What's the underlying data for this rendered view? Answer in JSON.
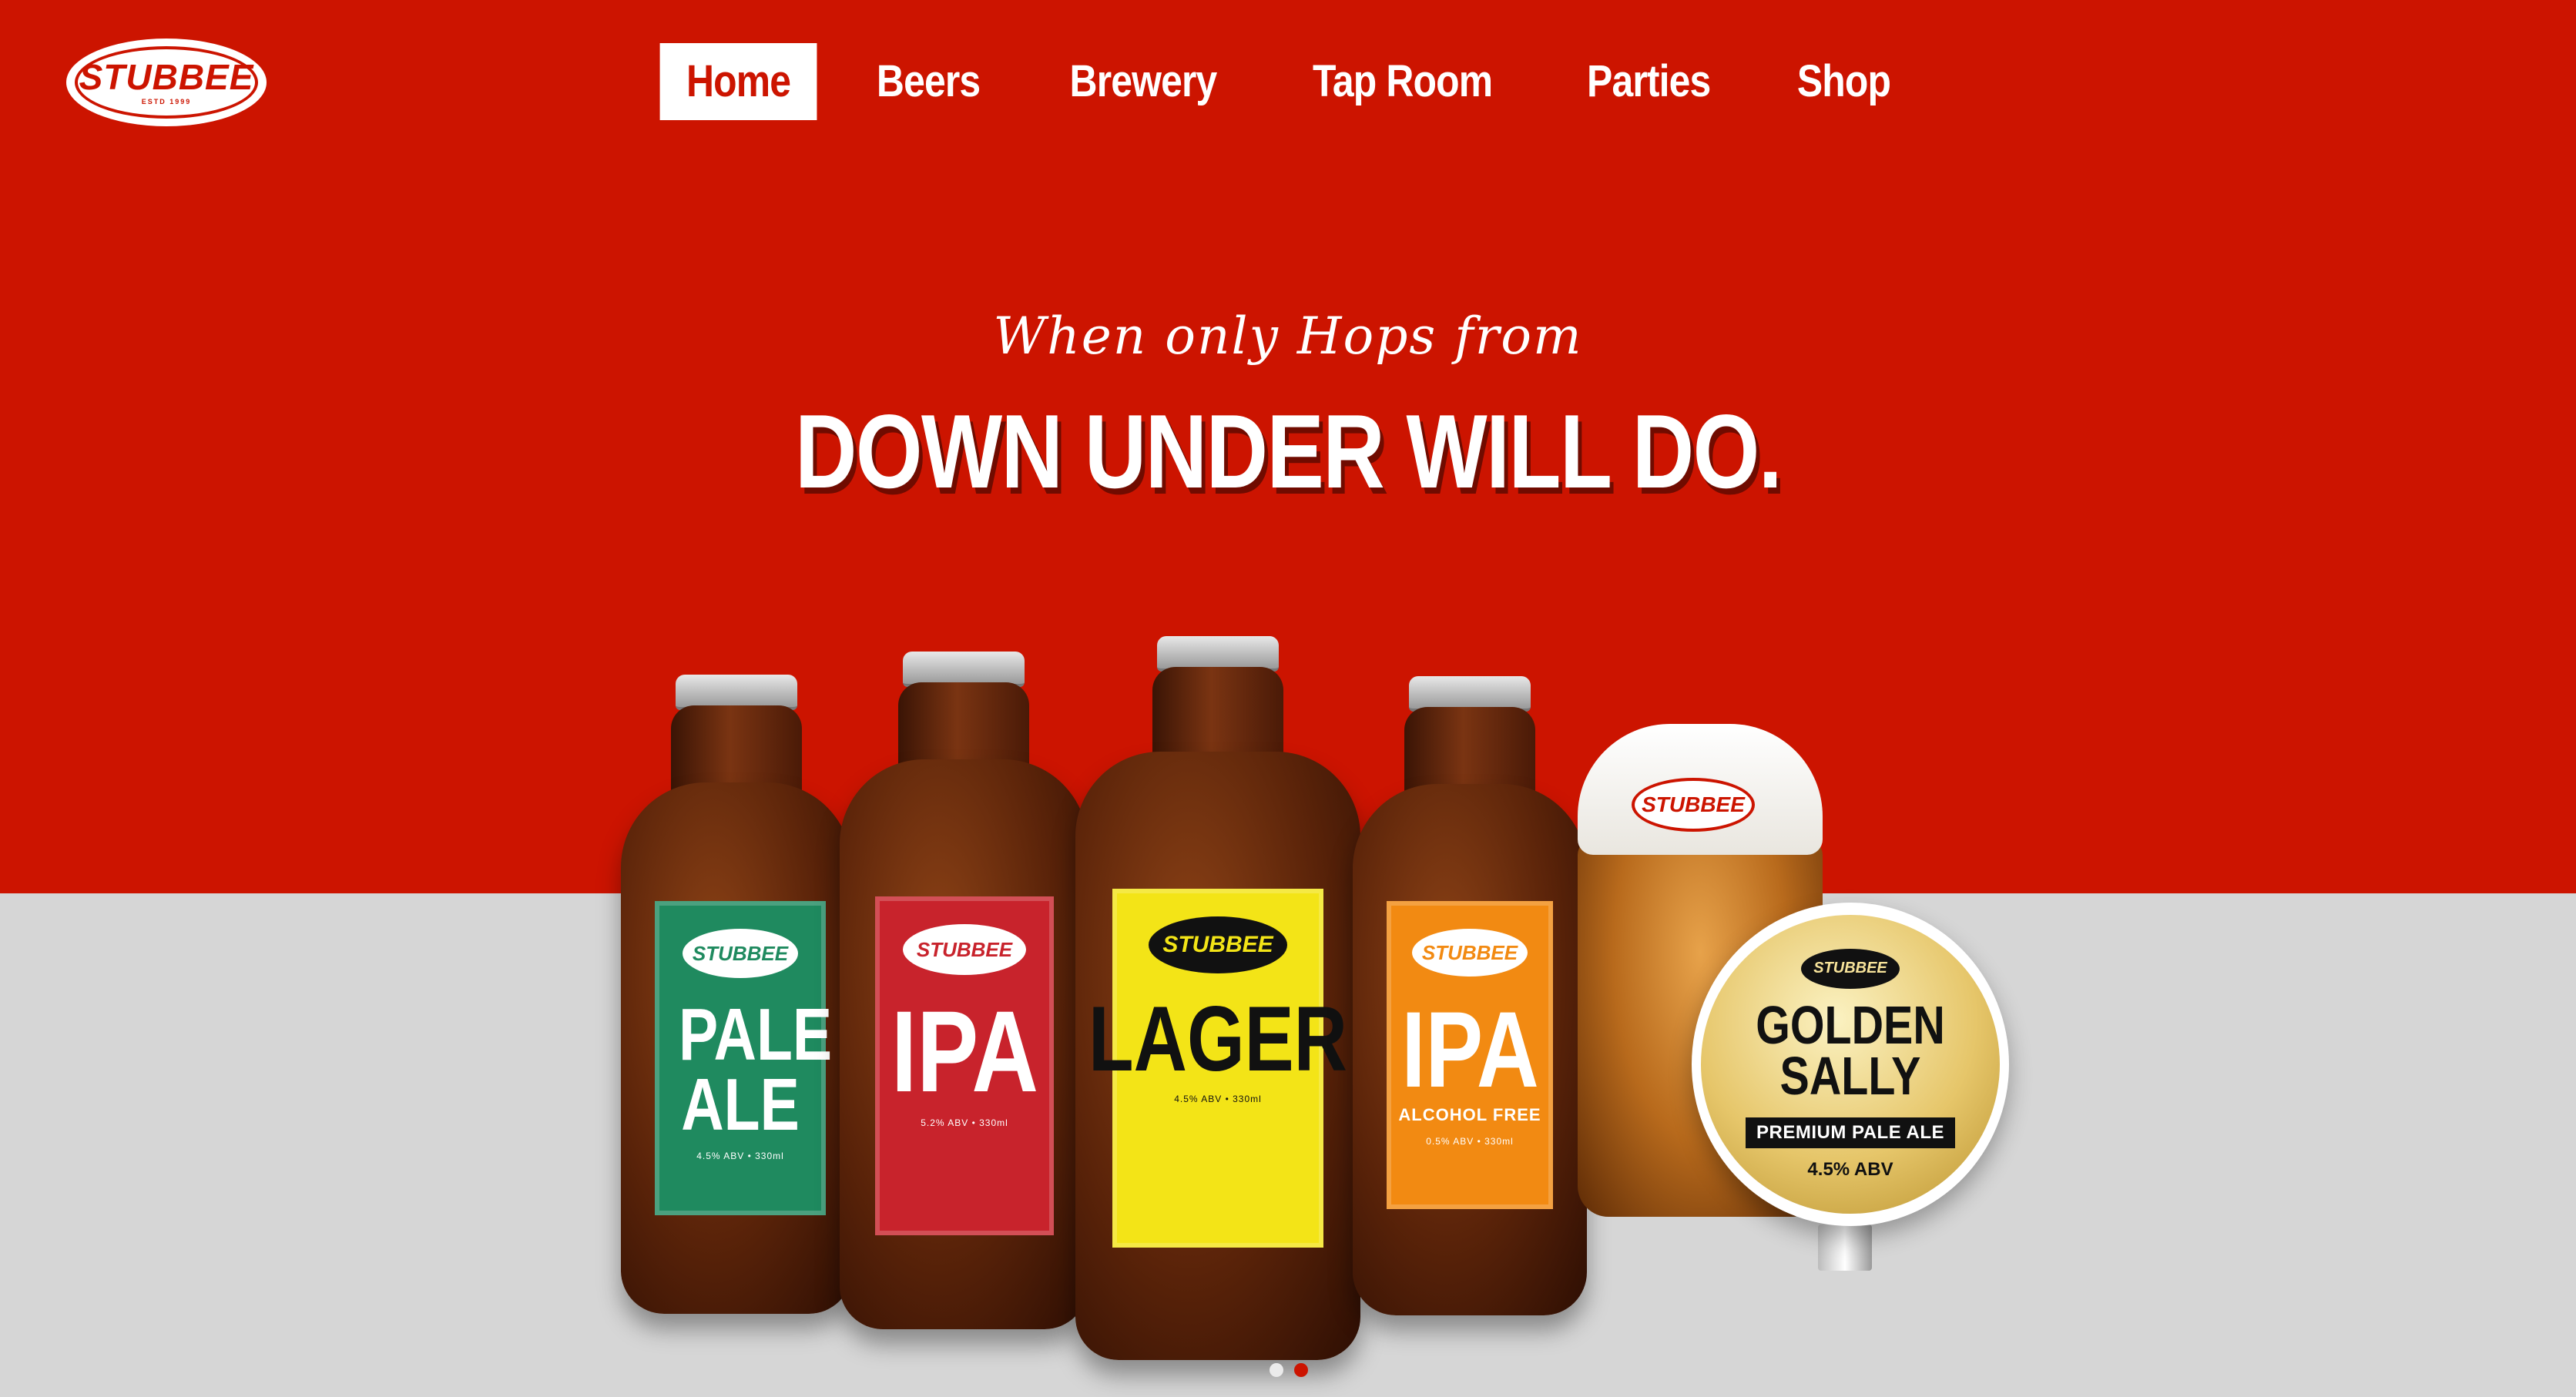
{
  "brand": {
    "logo_text": "STUBBEE",
    "logo_sub": "ESTD 1999",
    "accent": "#cc1400"
  },
  "nav": {
    "items": [
      {
        "label": "Home",
        "active": true
      },
      {
        "label": "Beers",
        "active": false
      },
      {
        "label": "Brewery",
        "active": false
      },
      {
        "label": "Tap Room",
        "active": false
      },
      {
        "label": "Parties",
        "active": false
      },
      {
        "label": "Shop",
        "active": false
      }
    ]
  },
  "hero": {
    "tagline": "When only Hops from",
    "headline": "DOWN UNDER WILL DO."
  },
  "products": {
    "bottles": [
      {
        "brand": "STUBBEE",
        "name": "PALE ALE",
        "sub": "",
        "details": "4.5% ABV • 330ml",
        "label_color": "#1f8a5f",
        "brand_color": "#1f8a5f"
      },
      {
        "brand": "STUBBEE",
        "name": "IPA",
        "sub": "",
        "details": "5.2% ABV • 330ml",
        "label_color": "#c8232c",
        "brand_color": "#c8232c"
      },
      {
        "brand": "STUBBEE",
        "name": "LAGER",
        "sub": "",
        "details": "4.5% ABV • 330ml",
        "label_color": "#f3e417",
        "brand_color": "#f3e417"
      },
      {
        "brand": "STUBBEE",
        "name": "IPA",
        "sub": "ALCOHOL FREE",
        "details": "0.5% ABV • 330ml",
        "label_color": "#f28a12",
        "brand_color": "#f28a12"
      }
    ],
    "glass_logo": "STUBBEE",
    "badge": {
      "brand": "STUBBEE",
      "title": "GOLDEN SALLY",
      "strip": "PREMIUM PALE ALE",
      "abv": "4.5% ABV"
    }
  },
  "carousel": {
    "slides": 2,
    "active_index": 1
  }
}
